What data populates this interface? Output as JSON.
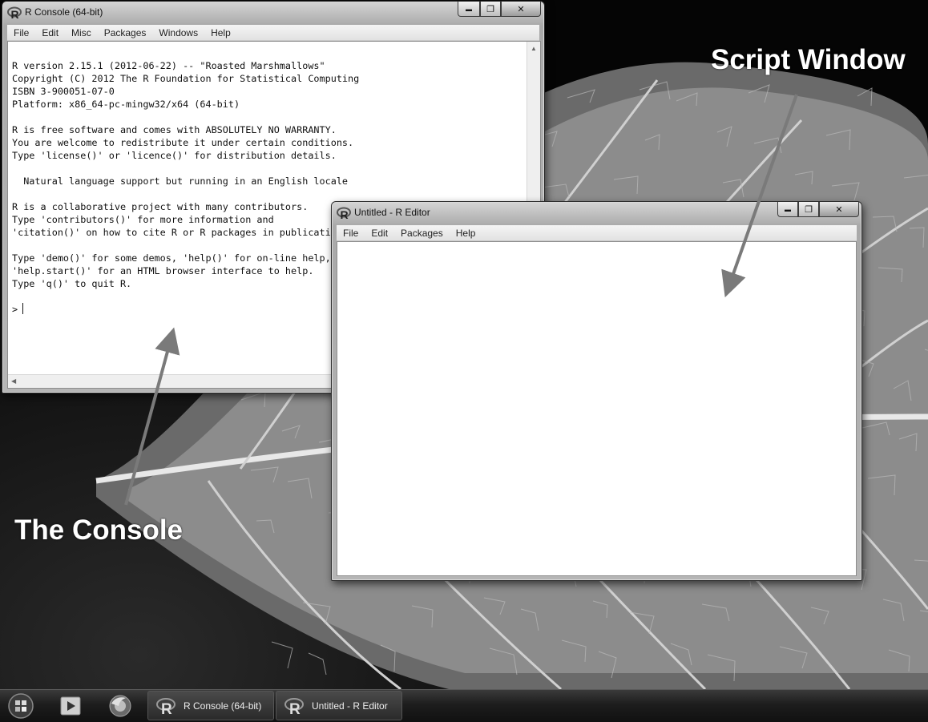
{
  "console": {
    "title": "R Console (64-bit)",
    "menu": [
      "File",
      "Edit",
      "Misc",
      "Packages",
      "Windows",
      "Help"
    ],
    "lines": [
      "R version 2.15.1 (2012-06-22) -- \"Roasted Marshmallows\"",
      "Copyright (C) 2012 The R Foundation for Statistical Computing",
      "ISBN 3-900051-07-0",
      "Platform: x86_64-pc-mingw32/x64 (64-bit)",
      "",
      "R is free software and comes with ABSOLUTELY NO WARRANTY.",
      "You are welcome to redistribute it under certain conditions.",
      "Type 'license()' or 'licence()' for distribution details.",
      "",
      "  Natural language support but running in an English locale",
      "",
      "R is a collaborative project with many contributors.",
      "Type 'contributors()' for more information and",
      "'citation()' on how to cite R or R packages in publications.",
      "",
      "Type 'demo()' for some demos, 'help()' for on-line help, or",
      "'help.start()' for an HTML browser interface to help.",
      "Type 'q()' to quit R.",
      ""
    ],
    "prompt": ">"
  },
  "editor": {
    "title": "Untitled - R Editor",
    "menu": [
      "File",
      "Edit",
      "Packages",
      "Help"
    ]
  },
  "annotations": {
    "script_label": "Script Window",
    "console_label": "The Console"
  },
  "taskbar": {
    "tasks": [
      {
        "label": "R Console (64-bit)"
      },
      {
        "label": "Untitled - R Editor"
      }
    ],
    "icons": [
      "windows-start-orb-icon",
      "media-player-icon",
      "firefox-icon"
    ]
  },
  "caption_buttons": {
    "minimize": "▬",
    "maximize": "❐",
    "close": "✕"
  }
}
